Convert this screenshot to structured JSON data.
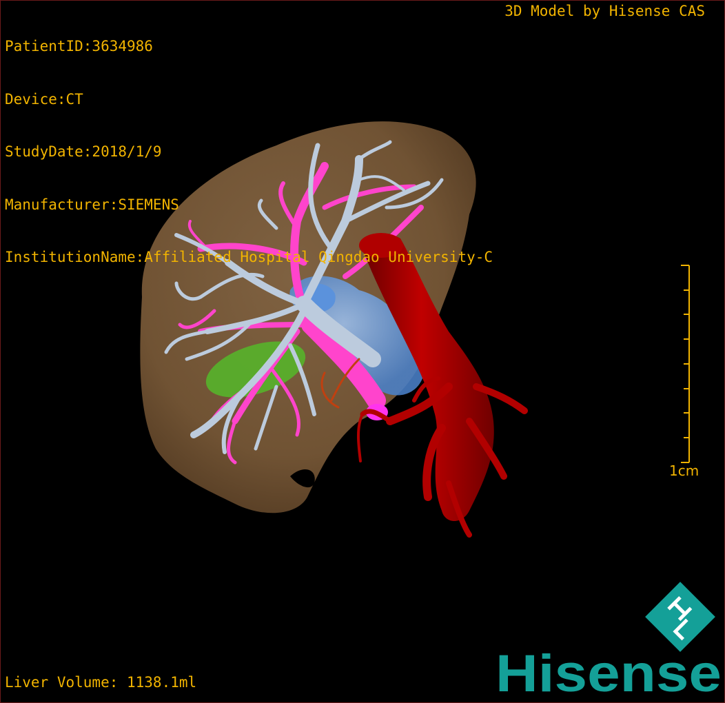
{
  "overlay": {
    "patient_id": "PatientID:3634986",
    "device": "Device:CT",
    "study_date": "StudyDate:2018/1/9",
    "manufacturer": "Manufacturer:SIEMENS",
    "institution": "InstitutionName:Affiliated Hospital Qingdao University-C",
    "brand": "3D Model by Hisense CAS",
    "liver_volume": "Liver Volume: 1138.1ml",
    "scale_label": "1cm"
  },
  "logo": {
    "mark_text": "HL",
    "wordmark": "Hisense"
  },
  "colors": {
    "overlay_text": "#f2b400",
    "liver": "#8b6a43",
    "portal_vein": "#b8c8dc",
    "hepatic_vein": "#ff44cc",
    "artery_aorta": "#a80000",
    "ivc": "#6aa0e0",
    "gallbladder": "#55b82a",
    "logo_teal": "#14a098"
  }
}
